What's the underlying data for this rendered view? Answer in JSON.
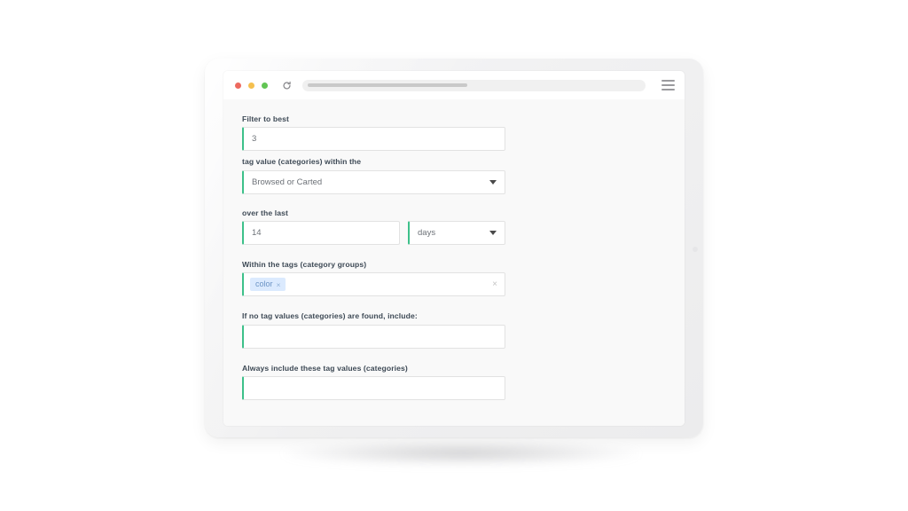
{
  "browser": {
    "traffic_lights": [
      "close",
      "minimize",
      "maximize"
    ],
    "reload_label": "reload-icon",
    "url_value": "",
    "menu_label": "menu-icon"
  },
  "form": {
    "fields": [
      {
        "label": "Filter to best",
        "value": "3",
        "type": "number"
      },
      {
        "label": "tag value (categories) within the",
        "value": "Browsed or Carted",
        "type": "select"
      },
      {
        "label": "over the last",
        "value": "14",
        "type": "number",
        "unit_value": "days",
        "unit_type": "select"
      },
      {
        "label": "Within the tags (category groups)",
        "type": "tags",
        "chips": [
          "color"
        ],
        "chip_remove": "×",
        "clear_all": "×"
      },
      {
        "label": "If no tag values (categories) are found, include:",
        "value": "",
        "type": "text"
      },
      {
        "label": "Always include these tag values (categories)",
        "value": "",
        "type": "text"
      }
    ]
  },
  "colors": {
    "accent_green": "#3dc08a",
    "chip_bg": "#dbeafe",
    "chip_text": "#6b93c4",
    "label_text": "#3e4a56",
    "page_bg": "#f9f9f9"
  }
}
